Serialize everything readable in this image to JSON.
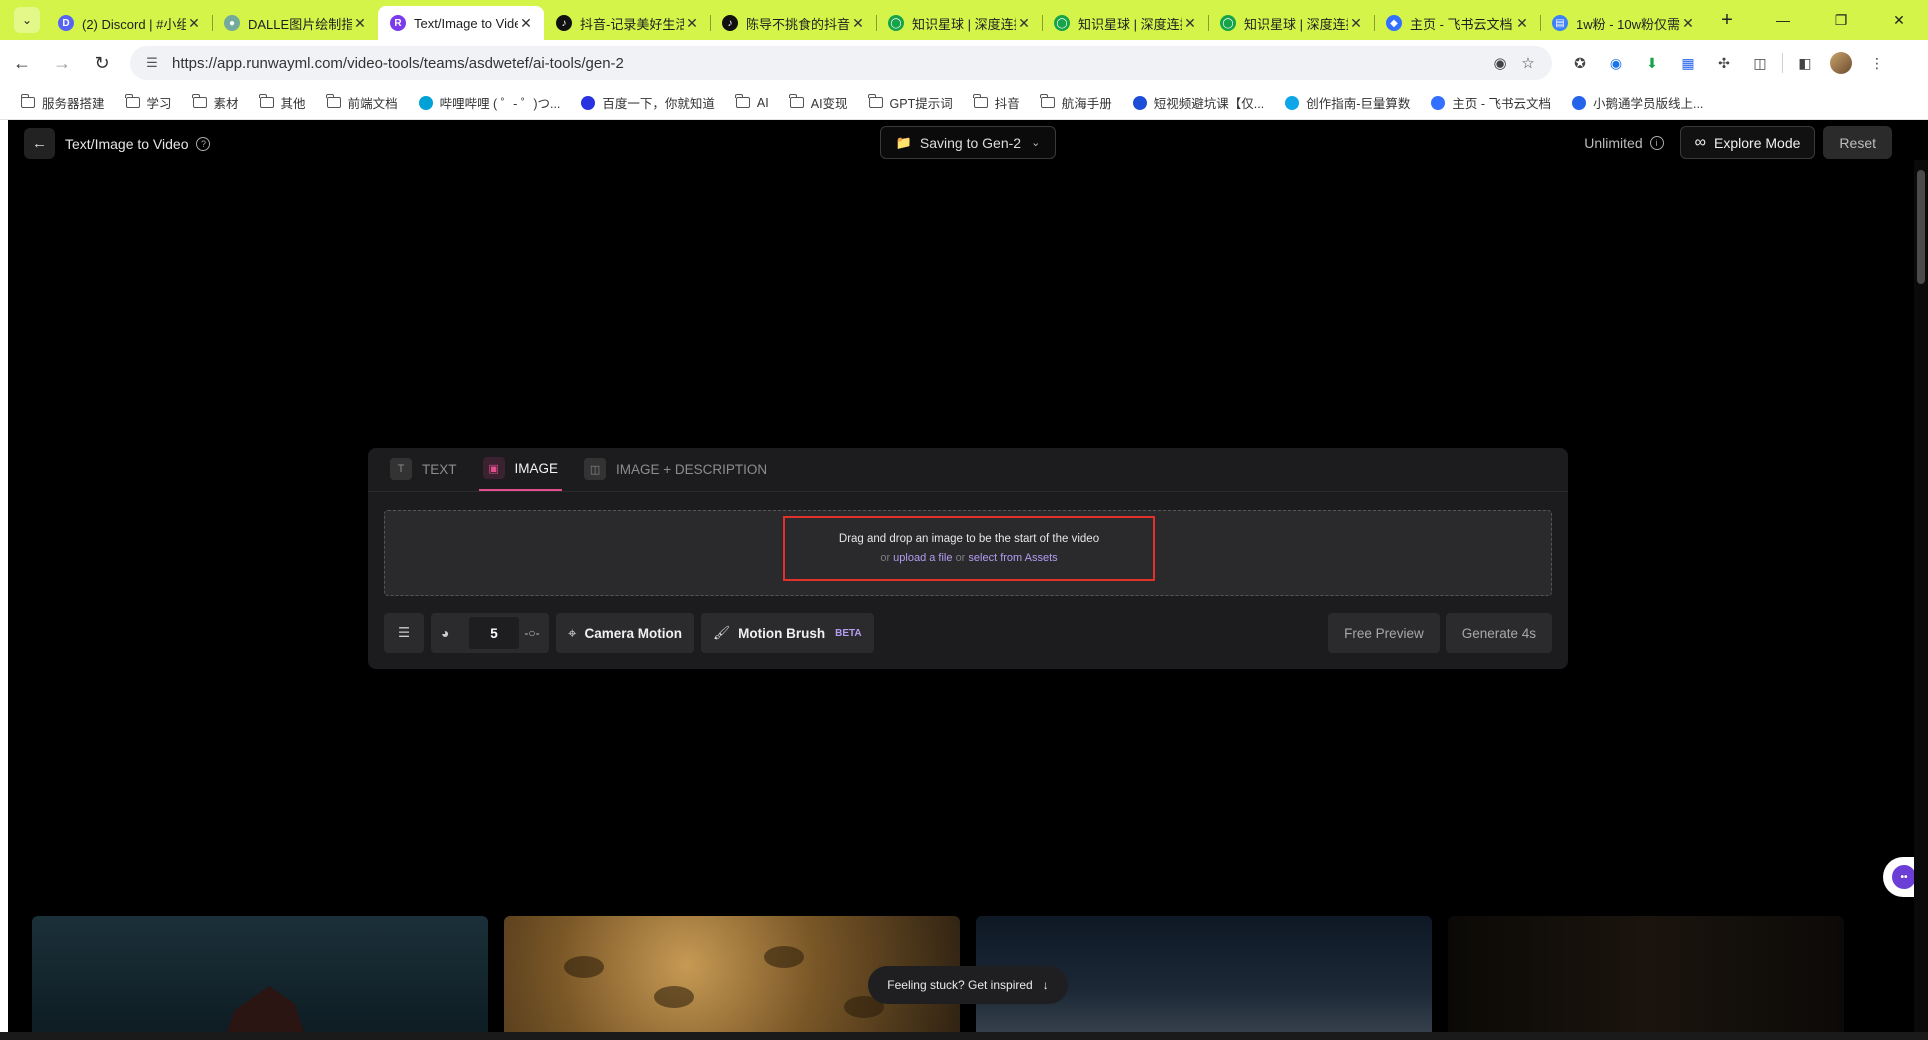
{
  "browser": {
    "tabs": [
      {
        "title": "(2) Discord | #小组",
        "favicon_color": "#5865f2",
        "favicon_glyph": "D",
        "active": false
      },
      {
        "title": "DALLE图片绘制指南",
        "favicon_color": "#74aa9c",
        "favicon_glyph": "●",
        "active": false
      },
      {
        "title": "Text/Image to Video",
        "favicon_color": "#7c3aed",
        "favicon_glyph": "R",
        "active": true
      },
      {
        "title": "抖音-记录美好生活",
        "favicon_color": "#111111",
        "favicon_glyph": "♪",
        "active": false
      },
      {
        "title": "陈导不挑食的抖音",
        "favicon_color": "#111111",
        "favicon_glyph": "♪",
        "active": false
      },
      {
        "title": "知识星球 | 深度连接",
        "favicon_color": "#16a34a",
        "favicon_glyph": "◯",
        "active": false
      },
      {
        "title": "知识星球 | 深度连接",
        "favicon_color": "#16a34a",
        "favicon_glyph": "◯",
        "active": false
      },
      {
        "title": "知识星球 | 深度连接",
        "favicon_color": "#16a34a",
        "favicon_glyph": "◯",
        "active": false
      },
      {
        "title": "主页 - 飞书云文档",
        "favicon_color": "#3370ff",
        "favicon_glyph": "◆",
        "active": false
      },
      {
        "title": "1w粉 - 10w粉仅需",
        "favicon_color": "#3b82f6",
        "favicon_glyph": "▤",
        "active": false
      }
    ],
    "url": "https://app.runwayml.com/video-tools/teams/asdwetef/ai-tools/gen-2",
    "bookmarks": [
      {
        "label": "服务器搭建",
        "type": "folder"
      },
      {
        "label": "学习",
        "type": "folder"
      },
      {
        "label": "素材",
        "type": "folder"
      },
      {
        "label": "其他",
        "type": "folder"
      },
      {
        "label": "前端文档",
        "type": "folder"
      },
      {
        "label": "哔哩哔哩 ( ゜- ゜)つ...",
        "type": "link",
        "color": "#00a1d6"
      },
      {
        "label": "百度一下，你就知道",
        "type": "link",
        "color": "#2932e1"
      },
      {
        "label": "AI",
        "type": "folder"
      },
      {
        "label": "AI变现",
        "type": "folder"
      },
      {
        "label": "GPT提示词",
        "type": "folder"
      },
      {
        "label": "抖音",
        "type": "folder"
      },
      {
        "label": "航海手册",
        "type": "folder"
      },
      {
        "label": "短视频避坑课【仅...",
        "type": "link",
        "color": "#1d4ed8"
      },
      {
        "label": "创作指南-巨量算数",
        "type": "link",
        "color": "#0ea5e9"
      },
      {
        "label": "主页 - 飞书云文档",
        "type": "link",
        "color": "#3370ff"
      },
      {
        "label": "小鹅通学员版线上...",
        "type": "link",
        "color": "#2563eb"
      }
    ]
  },
  "app": {
    "title": "Text/Image to Video",
    "saving_label": "Saving to Gen-2",
    "unlimited_label": "Unlimited",
    "explore_label": "Explore Mode",
    "reset_label": "Reset",
    "mode_tabs": [
      {
        "label": "TEXT",
        "icon": "text-icon",
        "active": false
      },
      {
        "label": "IMAGE",
        "icon": "image-icon",
        "active": true
      },
      {
        "label": "IMAGE + DESCRIPTION",
        "icon": "image-description-icon",
        "active": false
      }
    ],
    "dropzone": {
      "main_text": "Drag and drop an image to be the start of the video",
      "or1": "or",
      "upload_link": "upload a file",
      "or2": "or",
      "assets_link": "select from Assets"
    },
    "controls": {
      "motion_value": "5",
      "camera_label": "Camera Motion",
      "brush_label": "Motion Brush",
      "beta_label": "BETA",
      "preview_label": "Free Preview",
      "generate_label": "Generate 4s"
    },
    "inspire_label": "Feeling stuck? Get inspired",
    "accent_color": "#e24e8e",
    "link_color": "#b49cf2"
  }
}
